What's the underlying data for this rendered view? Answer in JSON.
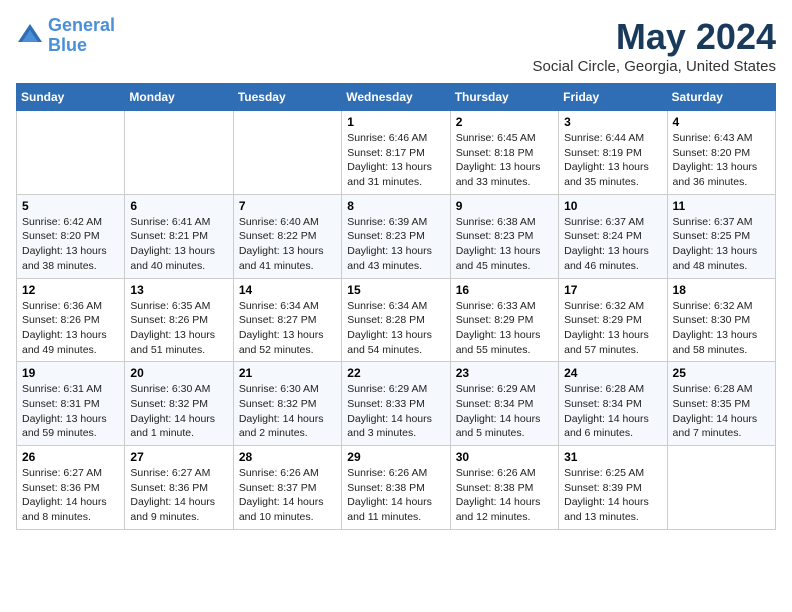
{
  "header": {
    "logo_line1": "General",
    "logo_line2": "Blue",
    "month_title": "May 2024",
    "location": "Social Circle, Georgia, United States"
  },
  "days_of_week": [
    "Sunday",
    "Monday",
    "Tuesday",
    "Wednesday",
    "Thursday",
    "Friday",
    "Saturday"
  ],
  "weeks": [
    [
      {
        "day": "",
        "info": ""
      },
      {
        "day": "",
        "info": ""
      },
      {
        "day": "",
        "info": ""
      },
      {
        "day": "1",
        "info": "Sunrise: 6:46 AM\nSunset: 8:17 PM\nDaylight: 13 hours and 31 minutes."
      },
      {
        "day": "2",
        "info": "Sunrise: 6:45 AM\nSunset: 8:18 PM\nDaylight: 13 hours and 33 minutes."
      },
      {
        "day": "3",
        "info": "Sunrise: 6:44 AM\nSunset: 8:19 PM\nDaylight: 13 hours and 35 minutes."
      },
      {
        "day": "4",
        "info": "Sunrise: 6:43 AM\nSunset: 8:20 PM\nDaylight: 13 hours and 36 minutes."
      }
    ],
    [
      {
        "day": "5",
        "info": "Sunrise: 6:42 AM\nSunset: 8:20 PM\nDaylight: 13 hours and 38 minutes."
      },
      {
        "day": "6",
        "info": "Sunrise: 6:41 AM\nSunset: 8:21 PM\nDaylight: 13 hours and 40 minutes."
      },
      {
        "day": "7",
        "info": "Sunrise: 6:40 AM\nSunset: 8:22 PM\nDaylight: 13 hours and 41 minutes."
      },
      {
        "day": "8",
        "info": "Sunrise: 6:39 AM\nSunset: 8:23 PM\nDaylight: 13 hours and 43 minutes."
      },
      {
        "day": "9",
        "info": "Sunrise: 6:38 AM\nSunset: 8:23 PM\nDaylight: 13 hours and 45 minutes."
      },
      {
        "day": "10",
        "info": "Sunrise: 6:37 AM\nSunset: 8:24 PM\nDaylight: 13 hours and 46 minutes."
      },
      {
        "day": "11",
        "info": "Sunrise: 6:37 AM\nSunset: 8:25 PM\nDaylight: 13 hours and 48 minutes."
      }
    ],
    [
      {
        "day": "12",
        "info": "Sunrise: 6:36 AM\nSunset: 8:26 PM\nDaylight: 13 hours and 49 minutes."
      },
      {
        "day": "13",
        "info": "Sunrise: 6:35 AM\nSunset: 8:26 PM\nDaylight: 13 hours and 51 minutes."
      },
      {
        "day": "14",
        "info": "Sunrise: 6:34 AM\nSunset: 8:27 PM\nDaylight: 13 hours and 52 minutes."
      },
      {
        "day": "15",
        "info": "Sunrise: 6:34 AM\nSunset: 8:28 PM\nDaylight: 13 hours and 54 minutes."
      },
      {
        "day": "16",
        "info": "Sunrise: 6:33 AM\nSunset: 8:29 PM\nDaylight: 13 hours and 55 minutes."
      },
      {
        "day": "17",
        "info": "Sunrise: 6:32 AM\nSunset: 8:29 PM\nDaylight: 13 hours and 57 minutes."
      },
      {
        "day": "18",
        "info": "Sunrise: 6:32 AM\nSunset: 8:30 PM\nDaylight: 13 hours and 58 minutes."
      }
    ],
    [
      {
        "day": "19",
        "info": "Sunrise: 6:31 AM\nSunset: 8:31 PM\nDaylight: 13 hours and 59 minutes."
      },
      {
        "day": "20",
        "info": "Sunrise: 6:30 AM\nSunset: 8:32 PM\nDaylight: 14 hours and 1 minute."
      },
      {
        "day": "21",
        "info": "Sunrise: 6:30 AM\nSunset: 8:32 PM\nDaylight: 14 hours and 2 minutes."
      },
      {
        "day": "22",
        "info": "Sunrise: 6:29 AM\nSunset: 8:33 PM\nDaylight: 14 hours and 3 minutes."
      },
      {
        "day": "23",
        "info": "Sunrise: 6:29 AM\nSunset: 8:34 PM\nDaylight: 14 hours and 5 minutes."
      },
      {
        "day": "24",
        "info": "Sunrise: 6:28 AM\nSunset: 8:34 PM\nDaylight: 14 hours and 6 minutes."
      },
      {
        "day": "25",
        "info": "Sunrise: 6:28 AM\nSunset: 8:35 PM\nDaylight: 14 hours and 7 minutes."
      }
    ],
    [
      {
        "day": "26",
        "info": "Sunrise: 6:27 AM\nSunset: 8:36 PM\nDaylight: 14 hours and 8 minutes."
      },
      {
        "day": "27",
        "info": "Sunrise: 6:27 AM\nSunset: 8:36 PM\nDaylight: 14 hours and 9 minutes."
      },
      {
        "day": "28",
        "info": "Sunrise: 6:26 AM\nSunset: 8:37 PM\nDaylight: 14 hours and 10 minutes."
      },
      {
        "day": "29",
        "info": "Sunrise: 6:26 AM\nSunset: 8:38 PM\nDaylight: 14 hours and 11 minutes."
      },
      {
        "day": "30",
        "info": "Sunrise: 6:26 AM\nSunset: 8:38 PM\nDaylight: 14 hours and 12 minutes."
      },
      {
        "day": "31",
        "info": "Sunrise: 6:25 AM\nSunset: 8:39 PM\nDaylight: 14 hours and 13 minutes."
      },
      {
        "day": "",
        "info": ""
      }
    ]
  ]
}
